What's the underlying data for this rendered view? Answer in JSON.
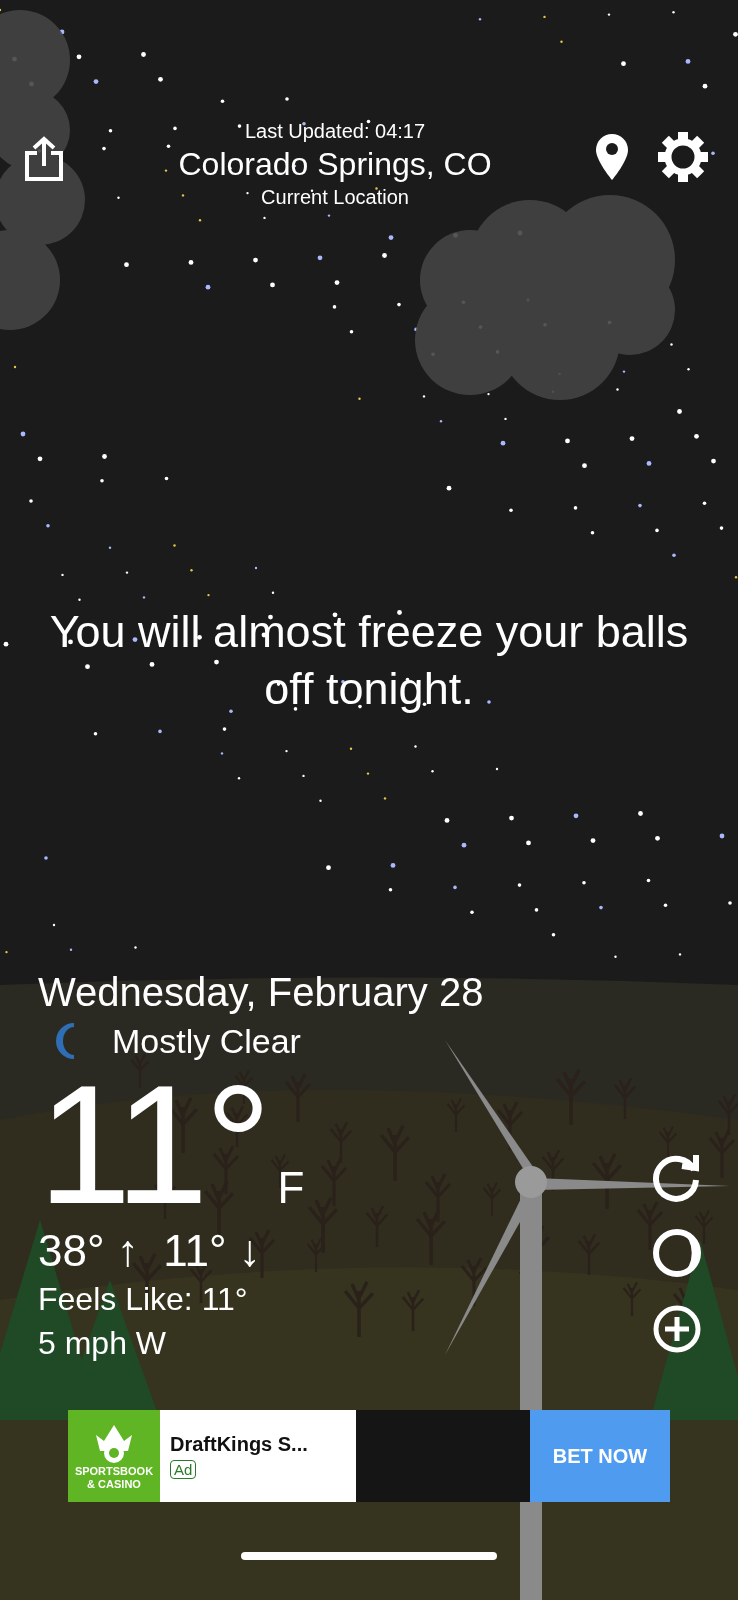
{
  "header": {
    "last_updated": "Last Updated: 04:17",
    "city": "Colorado Springs, CO",
    "location_label": "Current Location"
  },
  "message": "You will almost freeze your balls off tonight.",
  "weather": {
    "date": "Wednesday, February 28",
    "condition": "Mostly Clear",
    "temperature": "11°",
    "unit": "F",
    "high_low": "38° ↑  11° ↓",
    "feels_like": "Feels Like: 11°",
    "wind": "5 mph W"
  },
  "ad": {
    "logo_text": "SPORTSBOOK & CASINO",
    "title": "DraftKings S...",
    "badge": "Ad",
    "cta": "BET NOW"
  }
}
